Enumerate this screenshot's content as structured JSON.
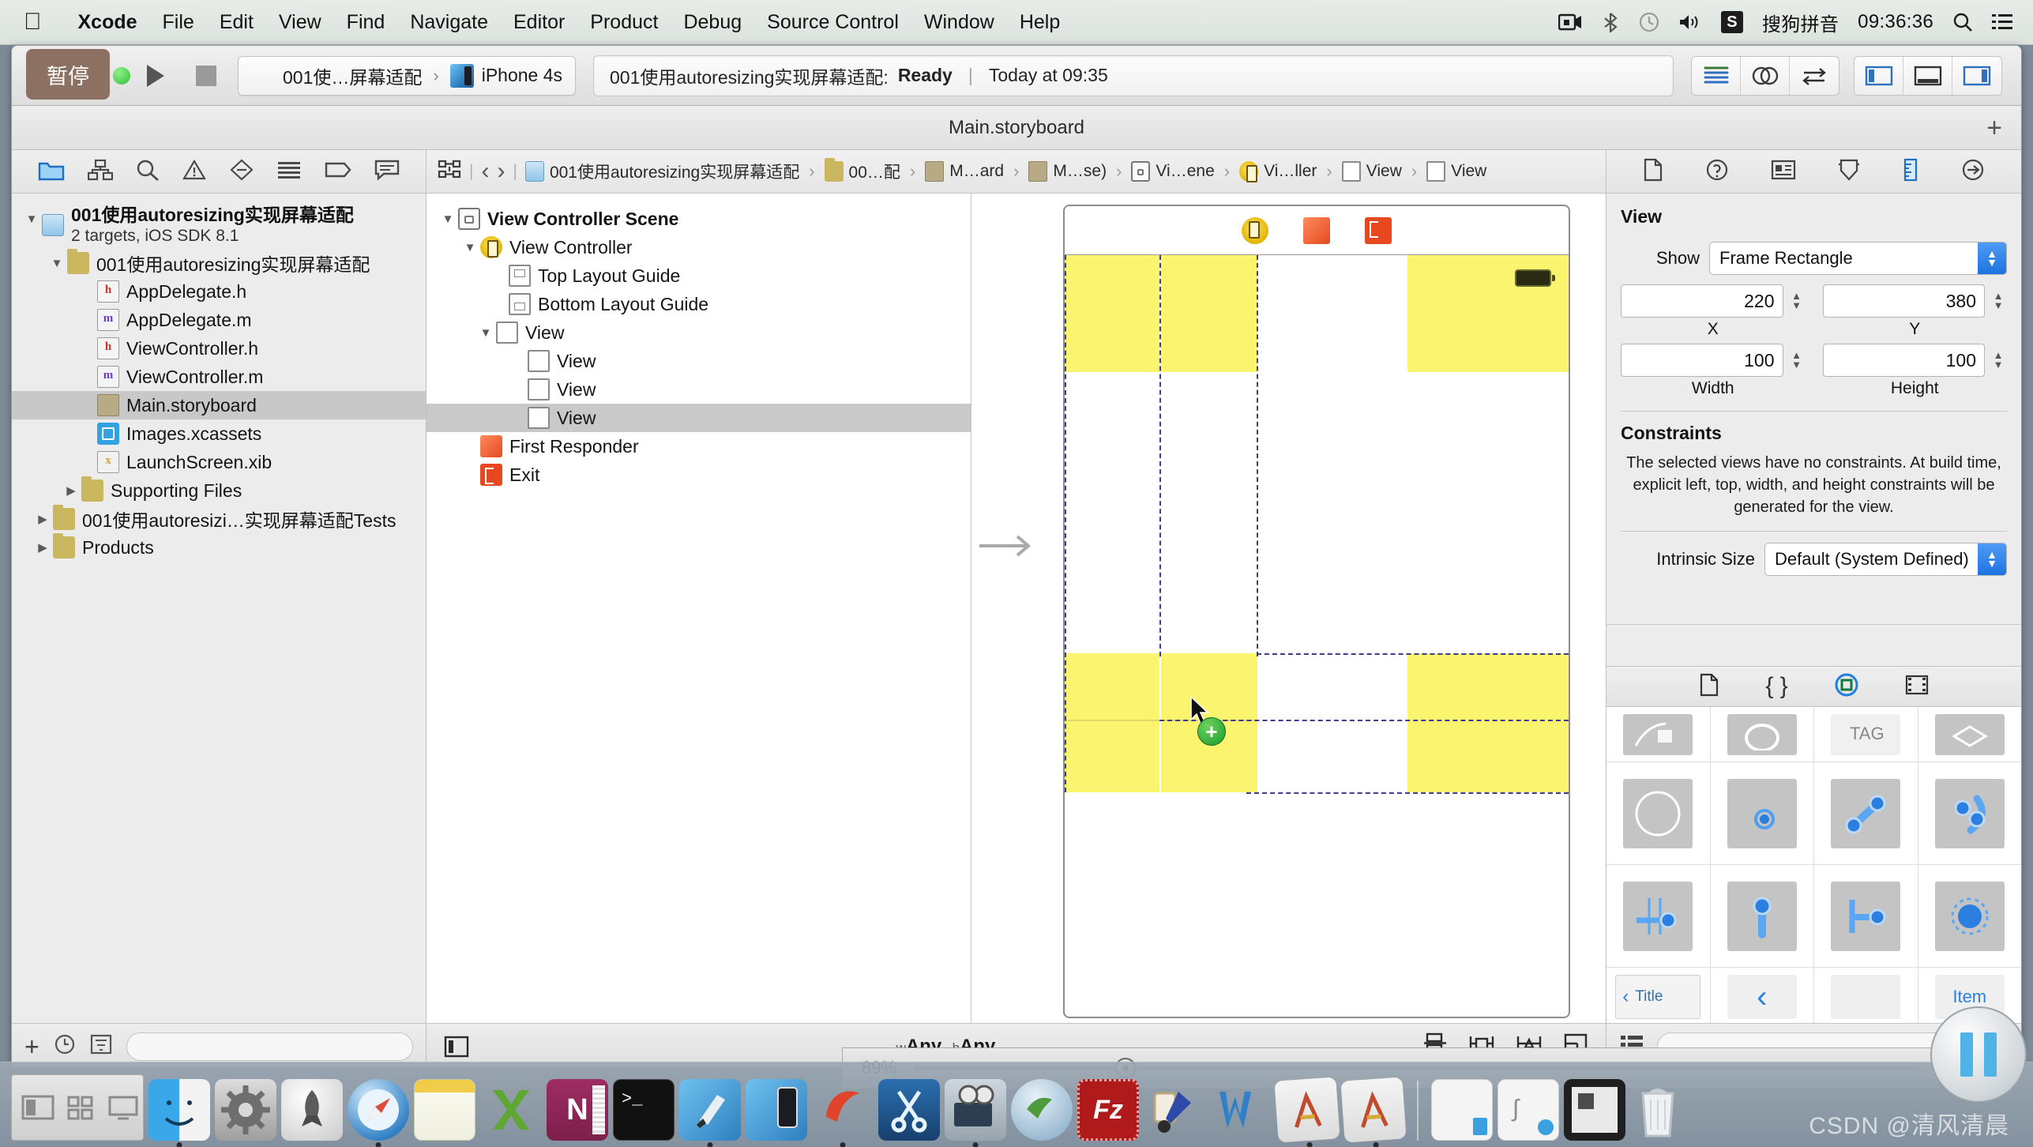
{
  "menubar": {
    "apple_icon": "apple-icon",
    "items": [
      {
        "label": "Xcode",
        "bold": true
      },
      {
        "label": "File",
        "bold": false
      },
      {
        "label": "Edit",
        "bold": false
      },
      {
        "label": "View",
        "bold": false
      },
      {
        "label": "Find",
        "bold": false
      },
      {
        "label": "Navigate",
        "bold": false
      },
      {
        "label": "Editor",
        "bold": false
      },
      {
        "label": "Product",
        "bold": false
      },
      {
        "label": "Debug",
        "bold": false
      },
      {
        "label": "Source Control",
        "bold": false
      },
      {
        "label": "Window",
        "bold": false
      },
      {
        "label": "Help",
        "bold": false
      }
    ],
    "status_icons": [
      "screen-recorder-icon",
      "bluetooth-icon",
      "time-machine-icon",
      "volume-icon"
    ],
    "input_method_badge": "S",
    "input_method_label": "搜狗拼音",
    "clock": "09:36:36",
    "search_icon": "search-icon",
    "notification_center_icon": "list-icon"
  },
  "toolbar": {
    "tooltip": "暂停",
    "run_button": "run-button",
    "stop_button": "stop-button",
    "scheme_name": "001使…屏幕适配",
    "destination": "iPhone 4s",
    "status_prefix": "001使用autoresizing实现屏幕适配:",
    "status_state": "Ready",
    "status_time": "Today at 09:35",
    "editor_segments": [
      "standard-editor-icon",
      "assistant-editor-icon",
      "version-editor-icon"
    ],
    "view_segments": [
      "toggle-navigator-icon",
      "toggle-debug-area-icon",
      "toggle-utilities-icon"
    ]
  },
  "titlebar": {
    "title": "Main.storyboard",
    "add_tab_label": "+"
  },
  "navigator": {
    "tabs": [
      "project-navigator-icon",
      "symbol-navigator-icon",
      "find-navigator-icon",
      "issue-navigator-icon",
      "test-navigator-icon",
      "debug-navigator-icon",
      "breakpoint-navigator-icon",
      "report-navigator-icon"
    ],
    "project": {
      "name": "001使用autoresizing实现屏幕适配",
      "subtitle": "2 targets, iOS SDK 8.1"
    },
    "items": [
      {
        "label": "001使用autoresizing实现屏幕适配",
        "icon": "folder-icon",
        "indent": 1,
        "twist": "open",
        "selected": false
      },
      {
        "label": "AppDelegate.h",
        "icon": "header-file-icon",
        "indent": 2,
        "twist": "",
        "selected": false
      },
      {
        "label": "AppDelegate.m",
        "icon": "source-file-icon",
        "indent": 2,
        "twist": "",
        "selected": false
      },
      {
        "label": "ViewController.h",
        "icon": "header-file-icon",
        "indent": 2,
        "twist": "",
        "selected": false
      },
      {
        "label": "ViewController.m",
        "icon": "source-file-icon",
        "indent": 2,
        "twist": "",
        "selected": false
      },
      {
        "label": "Main.storyboard",
        "icon": "storyboard-file-icon",
        "indent": 2,
        "twist": "",
        "selected": true
      },
      {
        "label": "Images.xcassets",
        "icon": "xcassets-icon",
        "indent": 2,
        "twist": "",
        "selected": false
      },
      {
        "label": "LaunchScreen.xib",
        "icon": "xib-file-icon",
        "indent": 2,
        "twist": "",
        "selected": false
      },
      {
        "label": "Supporting Files",
        "icon": "folder-icon",
        "indent": 1.6,
        "twist": "closed",
        "selected": false
      },
      {
        "label": "001使用autoresizi…实现屏幕适配Tests",
        "icon": "folder-icon",
        "indent": 0.6,
        "twist": "closed",
        "selected": false
      },
      {
        "label": "Products",
        "icon": "folder-icon",
        "indent": 0.6,
        "twist": "closed",
        "selected": false
      }
    ],
    "footer": {
      "add_button": "+",
      "recent_icon": "clock-icon",
      "filter_icon": "filter-icon",
      "filter_placeholder": "",
      "filter_value": ""
    }
  },
  "jumpbar": {
    "related_icon": "related-items-icon",
    "back_icon": "‹",
    "forward_icon": "›",
    "crumbs": [
      {
        "label": "001使用autoresizing实现屏幕适配",
        "icon": "project-icon"
      },
      {
        "label": "00…配",
        "icon": "folder-icon"
      },
      {
        "label": "M…ard",
        "icon": "storyboard-icon"
      },
      {
        "label": "M…se)",
        "icon": "storyboard-icon"
      },
      {
        "label": "Vi…ene",
        "icon": "scene-icon"
      },
      {
        "label": "Vi…ller",
        "icon": "view-controller-icon"
      },
      {
        "label": "View",
        "icon": "view-icon"
      },
      {
        "label": "View",
        "icon": "view-icon"
      }
    ]
  },
  "outline": {
    "items": [
      {
        "label": "View Controller Scene",
        "icon": "scene-icon",
        "indent": 0,
        "twist": "open",
        "bold": true,
        "selected": false
      },
      {
        "label": "View Controller",
        "icon": "view-controller-icon",
        "indent": 1,
        "twist": "open",
        "bold": false,
        "selected": false
      },
      {
        "label": "Top Layout Guide",
        "icon": "top-layout-guide-icon",
        "indent": 2,
        "twist": "",
        "bold": false,
        "selected": false
      },
      {
        "label": "Bottom Layout Guide",
        "icon": "bottom-layout-guide-icon",
        "indent": 2,
        "twist": "",
        "bold": false,
        "selected": false
      },
      {
        "label": "View",
        "icon": "view-icon",
        "indent": 2,
        "twist": "open",
        "bold": false,
        "selected": false
      },
      {
        "label": "View",
        "icon": "view-icon",
        "indent": 3,
        "twist": "",
        "bold": false,
        "selected": false
      },
      {
        "label": "View",
        "icon": "view-icon",
        "indent": 3,
        "twist": "",
        "bold": false,
        "selected": false
      },
      {
        "label": "View",
        "icon": "view-icon",
        "indent": 3,
        "twist": "",
        "bold": false,
        "selected": true
      },
      {
        "label": "First Responder",
        "icon": "first-responder-icon",
        "indent": 1,
        "twist": "",
        "bold": false,
        "selected": false
      },
      {
        "label": "Exit",
        "icon": "exit-icon",
        "indent": 1,
        "twist": "",
        "bold": false,
        "selected": false
      }
    ]
  },
  "canvas": {
    "scene_dock_icons": [
      "view-controller-icon",
      "first-responder-icon",
      "exit-icon"
    ],
    "footer": {
      "toggle_outline_icon": "toggle-document-outline-icon",
      "size_class_w_prefix": "w",
      "size_class_w": "Any",
      "size_class_h_prefix": "h",
      "size_class_h": "Any",
      "tools": [
        "align-icon",
        "pin-icon",
        "resolve-issues-icon",
        "resizing-behavior-icon"
      ]
    }
  },
  "inspector": {
    "tabs": [
      "file-inspector-icon",
      "quick-help-icon",
      "identity-inspector-icon",
      "attributes-inspector-icon",
      "size-inspector-icon",
      "connections-inspector-icon"
    ],
    "section_title": "View",
    "show_label": "Show",
    "show_value": "Frame Rectangle",
    "x_value": "220",
    "x_label": "X",
    "y_value": "380",
    "y_label": "Y",
    "width_value": "100",
    "width_label": "Width",
    "height_value": "100",
    "height_label": "Height",
    "constraints_title": "Constraints",
    "constraints_note": "The selected views have no constraints. At build time, explicit left, top, width, and height constraints will be generated for the view.",
    "intrinsic_label": "Intrinsic Size",
    "intrinsic_value": "Default (System Defined)"
  },
  "library": {
    "tabs": [
      "file-template-library-icon",
      "code-snippet-library-icon",
      "object-library-icon",
      "media-library-icon"
    ],
    "items": [
      [
        "map-kit-view-icon",
        "activity-indicator-icon",
        "tag-view-icon",
        "gl-kit-view-icon"
      ],
      [
        "compass-icon",
        "single-point-icon",
        "two-point-segue-icon",
        "curved-segue-icon"
      ],
      [
        "center-align-icon",
        "pin-top-icon",
        "leading-edge-icon",
        "circle-fill-icon"
      ],
      [
        "navigation-bar-item-icon",
        "back-chevron-item-icon",
        "blank-bar-item-icon",
        "bar-button-item-icon"
      ]
    ],
    "item_labels": {
      "title": "Title",
      "item": "Item"
    },
    "footer": {
      "layout_icon": "grid-layout-icon",
      "filter_icon": "filter-icon",
      "filter_value": ""
    }
  },
  "dock": {
    "items": [
      {
        "name": "finder-icon",
        "running": true
      },
      {
        "name": "system-preferences-icon",
        "running": false
      },
      {
        "name": "launchpad-icon",
        "running": false
      },
      {
        "name": "safari-icon",
        "running": true
      },
      {
        "name": "notes-icon",
        "running": false
      },
      {
        "name": "microsoft-excel-icon",
        "running": false
      },
      {
        "name": "microsoft-onenote-icon",
        "running": false
      },
      {
        "name": "terminal-icon",
        "running": false
      },
      {
        "name": "xcode-icon",
        "running": true
      },
      {
        "name": "ios-simulator-icon",
        "running": false
      },
      {
        "name": "parallels-icon",
        "running": true
      },
      {
        "name": "snipaste-icon",
        "running": false
      },
      {
        "name": "quicktime-player-icon",
        "running": true
      },
      {
        "name": "ftp-client-icon",
        "running": false
      },
      {
        "name": "filezilla-icon",
        "running": false
      },
      {
        "name": "paint-tool-icon",
        "running": false
      },
      {
        "name": "microsoft-word-icon",
        "running": false
      },
      {
        "name": "sketch-a-icon",
        "running": true
      },
      {
        "name": "sketch-a-alt-icon",
        "running": true
      }
    ],
    "recent_items": [
      {
        "name": "recent-document-icon"
      },
      {
        "name": "recent-document-alt-icon"
      },
      {
        "name": "recent-screenshot-icon"
      }
    ],
    "trash": {
      "name": "trash-icon"
    }
  },
  "zoom_strip": {
    "value": "89%",
    "slider_position_pct": 20
  },
  "overlay": {
    "pause_widget": "pause-widget-icon",
    "watermark": "CSDN @清风清晨"
  }
}
